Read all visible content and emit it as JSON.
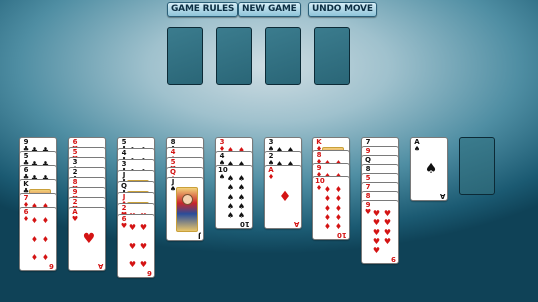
{
  "toolbar": {
    "game_rules": "GAME RULES",
    "new_game": "NEW GAME",
    "undo_move": "UNDO MOVE"
  },
  "colors": {
    "hearts": "#d41414",
    "diamonds": "#d41414",
    "clubs": "#111111",
    "spades": "#111111"
  },
  "foundations": [
    {
      "cards": []
    },
    {
      "cards": []
    },
    {
      "cards": []
    },
    {
      "cards": []
    }
  ],
  "tableau": [
    [
      "9♣",
      "5♣",
      "6♣",
      "K♣",
      "7♦",
      "6♦"
    ],
    [
      "6♥",
      "5♥",
      "3♠",
      "2♣",
      "8♥",
      "9♥",
      "2♥",
      "A♥"
    ],
    [
      "5♣",
      "4♣",
      "3♣",
      "J♣",
      "Q♣",
      "J♦",
      "2♥",
      "6♥"
    ],
    [
      "8♣",
      "4♦",
      "5♥",
      "Q♦",
      "J♠"
    ],
    [
      "3♦",
      "4♠",
      "10♠"
    ],
    [
      "3♠",
      "2♠",
      "A♦"
    ],
    [
      "K♦",
      "8♦",
      "9♦",
      "10♦"
    ],
    [
      "7♠",
      "9♦",
      "Q♣",
      "8♠",
      "5♦",
      "7♥",
      "8♦",
      "9♥"
    ]
  ],
  "stock": {
    "card": "A♠"
  },
  "waste": {
    "cards": []
  }
}
